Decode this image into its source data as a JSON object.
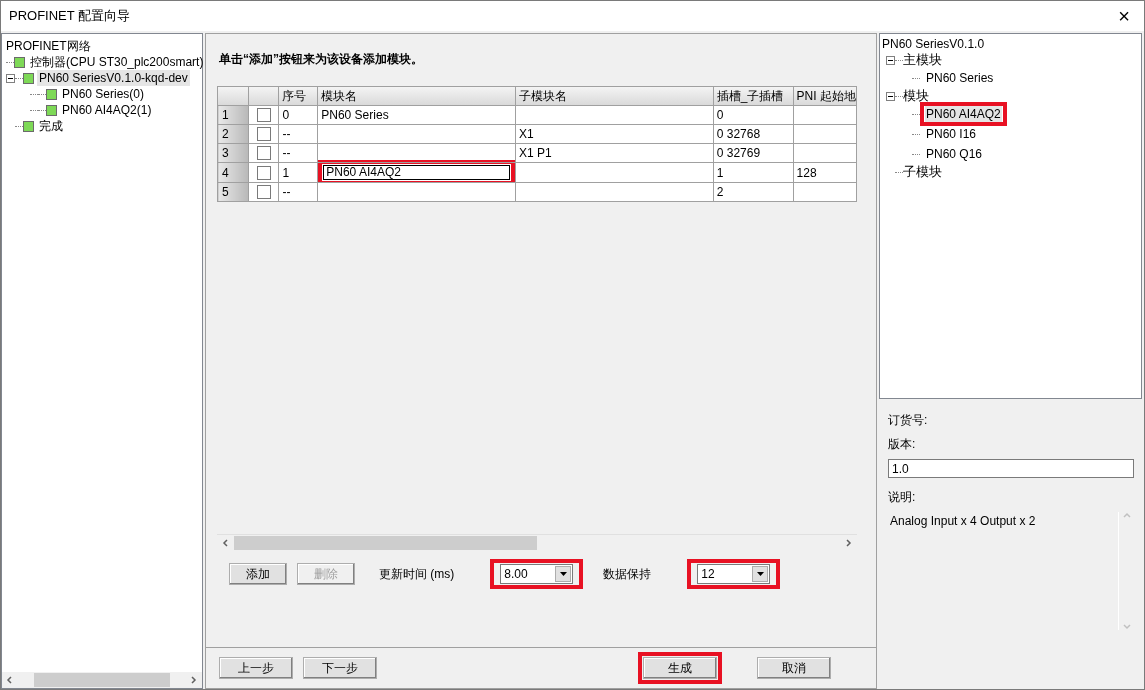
{
  "window": {
    "title": "PROFINET 配置向导",
    "close": "×"
  },
  "network_tree": {
    "root": "PROFINET网络",
    "items": [
      {
        "label": "控制器(CPU ST30_plc200smart)",
        "selected": false
      },
      {
        "label": "PN60 SeriesV0.1.0-kqd-dev",
        "selected": true,
        "expanded": true,
        "children": [
          {
            "label": "PN60 Series(0)",
            "selected": false
          },
          {
            "label": "PN60 AI4AQ2(1)",
            "selected": false
          }
        ]
      },
      {
        "label": "完成",
        "selected": false
      }
    ]
  },
  "instruction": "单击“添加”按钮来为该设备添加模块。",
  "table": {
    "columns": [
      "序号",
      "模块名",
      "子模块名",
      "插槽_子插槽",
      "PNI 起始地"
    ],
    "rows": [
      {
        "row": "1",
        "checked": false,
        "index": "0",
        "module": "PN60 Series",
        "submodule": "",
        "slot": "0",
        "pni": "",
        "highlighted": false
      },
      {
        "row": "2",
        "checked": false,
        "index": "--",
        "module": "",
        "submodule": "X1",
        "slot": "0 32768",
        "pni": "",
        "highlighted": false
      },
      {
        "row": "3",
        "checked": false,
        "index": "--",
        "module": "",
        "submodule": "X1 P1",
        "slot": "0 32769",
        "pni": "",
        "highlighted": false
      },
      {
        "row": "4",
        "checked": false,
        "index": "1",
        "module": "PN60 AI4AQ2",
        "submodule": "",
        "slot": "1",
        "pni": "128",
        "highlighted": true
      },
      {
        "row": "5",
        "checked": false,
        "index": "--",
        "module": "",
        "submodule": "",
        "slot": "2",
        "pni": "",
        "highlighted": false
      }
    ]
  },
  "module_buttons": [
    {
      "label": "添加",
      "disabled": false
    },
    {
      "label": "删除",
      "disabled": true
    }
  ],
  "settings": [
    {
      "label": "更新时间 (ms)",
      "value": "8.00",
      "highlighted": true
    },
    {
      "label": "数据保持",
      "value": "12",
      "highlighted": true
    }
  ],
  "nav_buttons": [
    {
      "label": "上一步",
      "highlighted": false
    },
    {
      "label": "下一步",
      "highlighted": false
    },
    {
      "label": "生成",
      "highlighted": true
    },
    {
      "label": "取消",
      "highlighted": false
    }
  ],
  "catalog_tree": {
    "root": "PN60 SeriesV0.1.0",
    "groups": [
      {
        "label": "主模块",
        "expanded": true,
        "children": [
          {
            "label": "PN60 Series",
            "selected": false,
            "highlighted": false
          }
        ]
      },
      {
        "label": "模块",
        "expanded": true,
        "children": [
          {
            "label": "PN60 AI4AQ2",
            "selected": true,
            "highlighted": true
          },
          {
            "label": "PN60 I16",
            "selected": false,
            "highlighted": false
          },
          {
            "label": "PN60 Q16",
            "selected": false,
            "highlighted": false
          }
        ]
      },
      {
        "label": "子模块"
      }
    ]
  },
  "details": {
    "order_number_label": "订货号:",
    "version_label": "版本:",
    "version": "1.0",
    "description_label": "说明:",
    "description": "Analog Input x 4 Output x 2"
  }
}
